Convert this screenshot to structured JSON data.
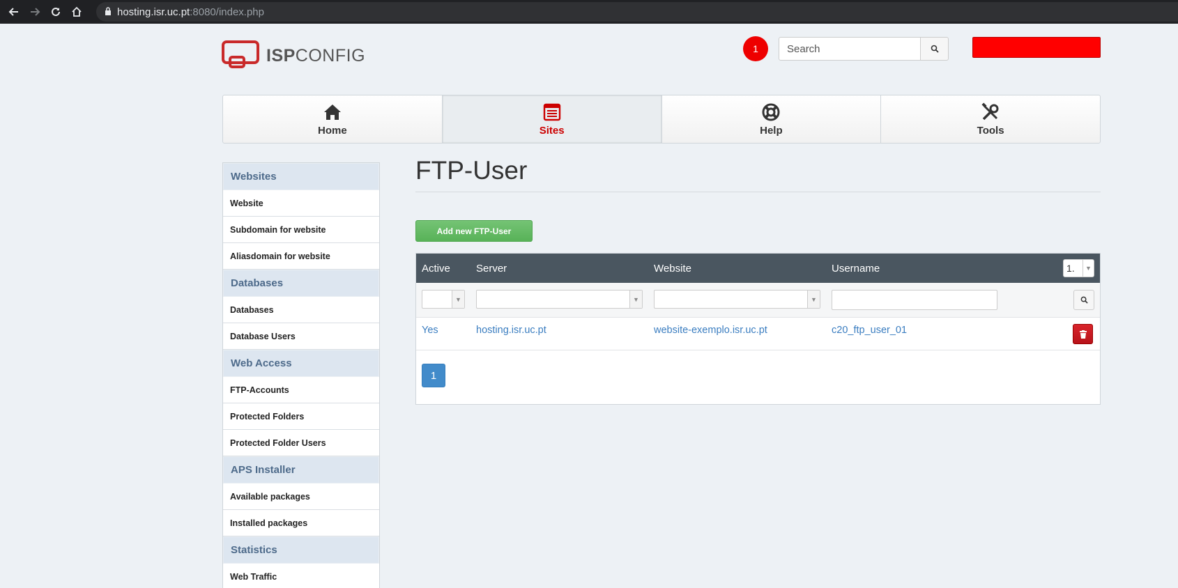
{
  "browser": {
    "url_host": "hosting.isr.uc.pt",
    "url_path": ":8080/index.php"
  },
  "header": {
    "logo_bold": "ISP",
    "logo_light": "CONFIG",
    "notification_count": "1",
    "search_placeholder": "Search"
  },
  "topnav": [
    {
      "label": "Home",
      "icon": "home-icon"
    },
    {
      "label": "Sites",
      "icon": "sites-icon",
      "active": true
    },
    {
      "label": "Help",
      "icon": "lifebuoy-icon"
    },
    {
      "label": "Tools",
      "icon": "tools-icon"
    }
  ],
  "sidebar": {
    "sections": [
      {
        "title": "Websites",
        "items": [
          "Website",
          "Subdomain for website",
          "Aliasdomain for website"
        ]
      },
      {
        "title": "Databases",
        "items": [
          "Databases",
          "Database Users"
        ]
      },
      {
        "title": "Web Access",
        "items": [
          "FTP-Accounts",
          "Protected Folders",
          "Protected Folder Users"
        ]
      },
      {
        "title": "APS Installer",
        "items": [
          "Available packages",
          "Installed packages"
        ]
      },
      {
        "title": "Statistics",
        "items": [
          "Web Traffic"
        ]
      }
    ]
  },
  "main": {
    "title": "FTP-User",
    "add_button": "Add new FTP-User",
    "columns": [
      "Active",
      "Server",
      "Website",
      "Username"
    ],
    "page_size": "1.",
    "rows": [
      {
        "active": "Yes",
        "server": "hosting.isr.uc.pt",
        "website": "website-exemplo.isr.uc.pt",
        "username": "c20_ftp_user_01"
      }
    ],
    "pagination": [
      "1"
    ]
  },
  "colors": {
    "accent_red": "#cc0000",
    "grid_header": "#4a5660",
    "add_button_green": "#5cb85c",
    "link_blue": "#3a7dc0",
    "pager_blue": "#428bca"
  }
}
